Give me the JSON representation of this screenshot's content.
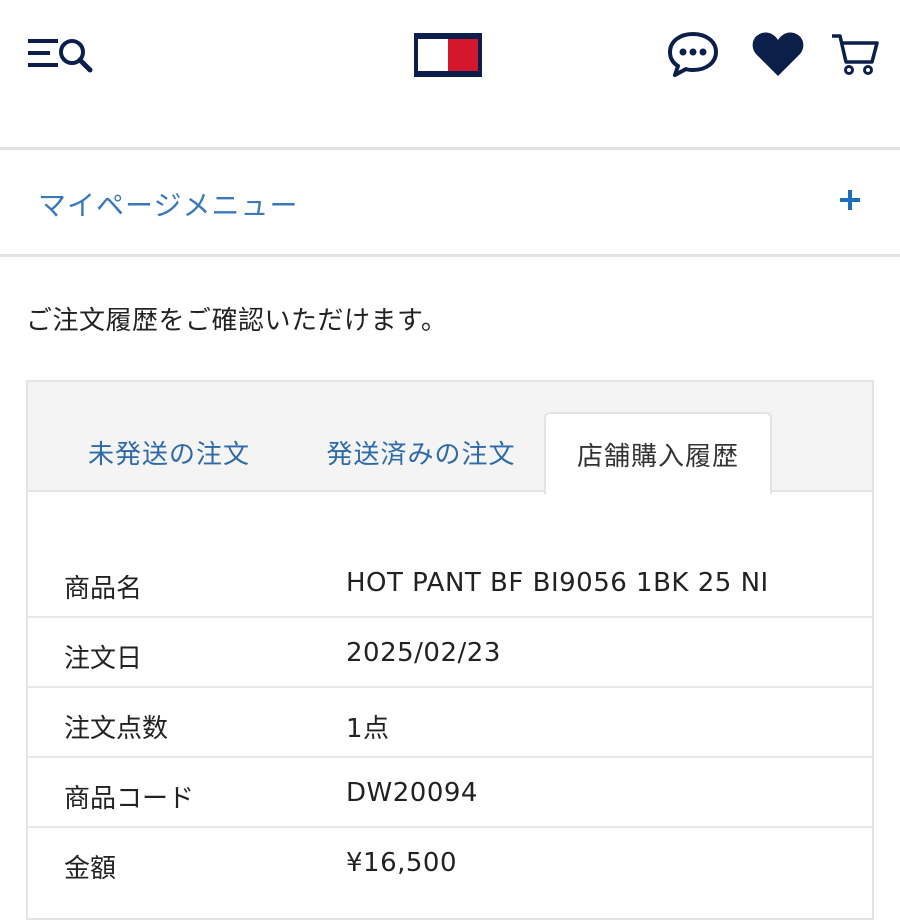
{
  "header": {
    "menu_search_icon": "menu-search-icon",
    "logo": "tommy-hilfiger-flag-logo",
    "chat_icon": "chat-bubble-icon",
    "wishlist_icon": "heart-icon",
    "cart_icon": "cart-icon"
  },
  "colors": {
    "navy": "#0c1f4b",
    "red": "#d5172d",
    "link_blue": "#3b78b8",
    "plus_blue": "#1e6fbf"
  },
  "mypage_menu": {
    "label": "マイページメニュー",
    "toggle_icon": "plus-icon"
  },
  "intro_text": "ご注文履歴をご確認いただけます。",
  "tabs": [
    {
      "label": "未発送の注文",
      "active": false
    },
    {
      "label": "発送済みの注文",
      "active": false
    },
    {
      "label": "店舗購入履歴",
      "active": true
    }
  ],
  "order": [
    {
      "label": "商品名",
      "value": "HOT PANT BF BI9056 1BK 25 NI"
    },
    {
      "label": "注文日",
      "value": "2025/02/23"
    },
    {
      "label": "注文点数",
      "value": "1点"
    },
    {
      "label": "商品コード",
      "value": "DW20094"
    },
    {
      "label": "金額",
      "value": "¥16,500"
    }
  ]
}
